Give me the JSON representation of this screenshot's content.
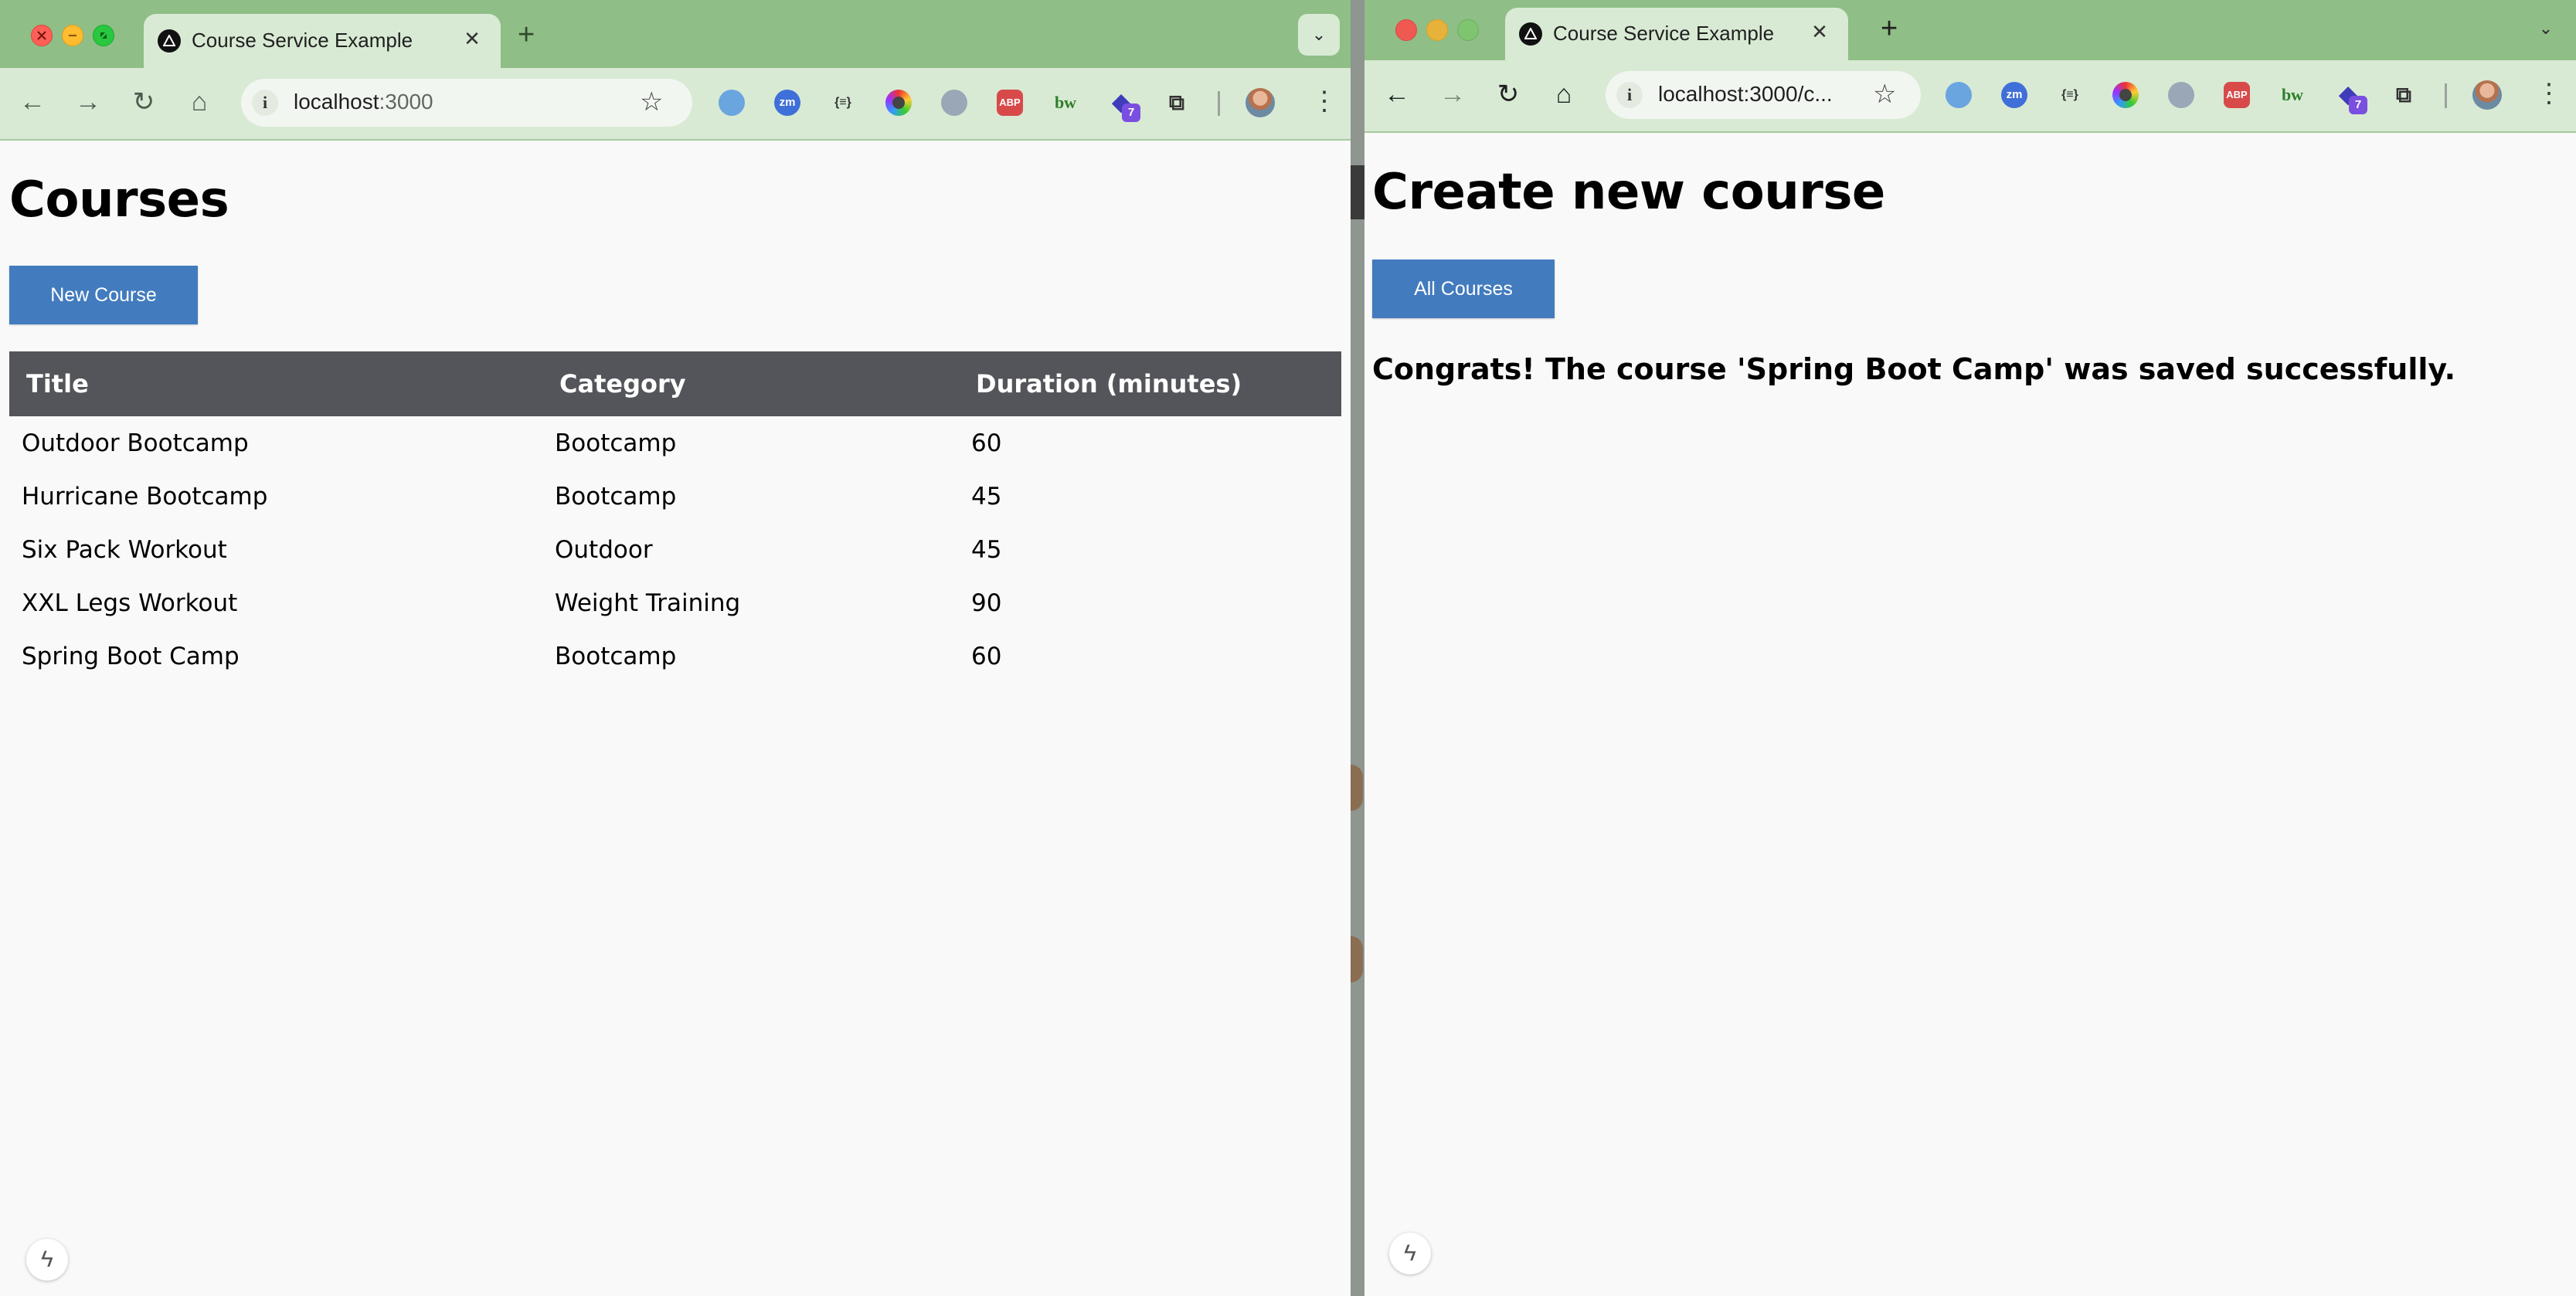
{
  "left_window": {
    "tab": {
      "title": "Course Service Example",
      "close": "✕"
    },
    "new_tab": "+",
    "address": {
      "host": "localhost",
      "port": ":3000"
    },
    "page": {
      "heading": "Courses",
      "new_course_button": "New Course",
      "table": {
        "headers": [
          "Title",
          "Category",
          "Duration (minutes)"
        ],
        "rows": [
          [
            "Outdoor Bootcamp",
            "Bootcamp",
            "60"
          ],
          [
            "Hurricane Bootcamp",
            "Bootcamp",
            "45"
          ],
          [
            "Six Pack Workout",
            "Outdoor",
            "45"
          ],
          [
            "XXL Legs Workout",
            "Weight Training",
            "90"
          ],
          [
            "Spring Boot Camp",
            "Bootcamp",
            "60"
          ]
        ]
      }
    }
  },
  "right_window": {
    "tab": {
      "title": "Course Service Example",
      "close": "✕"
    },
    "new_tab": "+",
    "address": {
      "url": "localhost:3000/c..."
    },
    "page": {
      "heading": "Create new course",
      "all_courses_button": "All Courses",
      "success_message": "Congrats! The course 'Spring Boot Camp' was saved successfully."
    }
  },
  "extensions": {
    "zm": "zm",
    "json": "{≡}",
    "abp": "ABP",
    "bw": "bw",
    "badge_count": "7"
  },
  "colors": {
    "tab_bar": "#8fbe87",
    "toolbar": "#d8ead4",
    "button": "#427bbe",
    "table_header": "#54555a",
    "page_bg": "#f9f9f9"
  }
}
